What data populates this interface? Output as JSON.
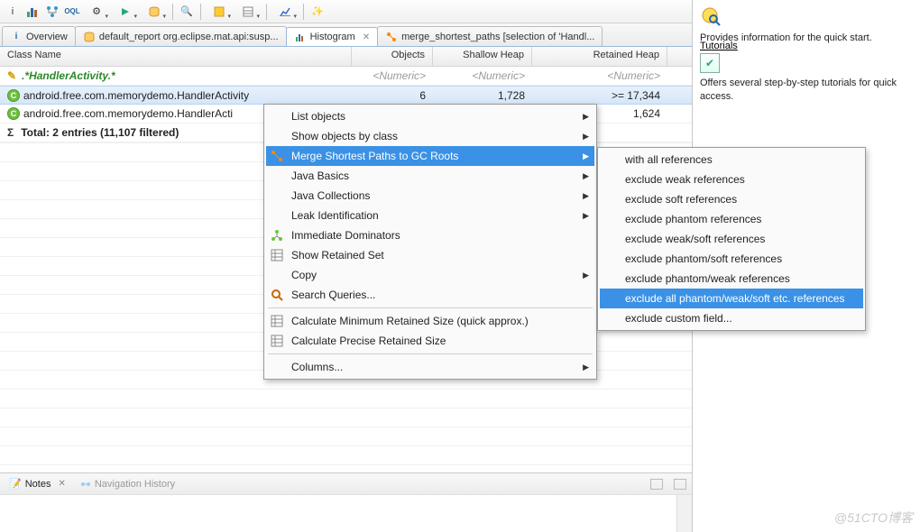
{
  "toolbar_icons": [
    "i",
    "bars",
    "tree",
    "OQL",
    "gear",
    "play",
    "db",
    "sep",
    "search",
    "cube",
    "table",
    "sep",
    "chart",
    "sep",
    "wand"
  ],
  "tabs": [
    {
      "icon": "i",
      "label": "Overview"
    },
    {
      "icon": "db",
      "label": "default_report  org.eclipse.mat.api:susp..."
    },
    {
      "icon": "histo",
      "label": "Histogram",
      "active": true,
      "closable": true
    },
    {
      "icon": "path",
      "label": "merge_shortest_paths [selection of 'Handl..."
    }
  ],
  "columns": [
    "Class Name",
    "Objects",
    "Shallow Heap",
    "Retained Heap"
  ],
  "numeric_placeholder": "<Numeric>",
  "regex_text": ".*HandlerActivity.*",
  "regex_icon": "R",
  "rows": [
    {
      "name": "android.free.com.memorydemo.HandlerActivity",
      "objects": "6",
      "shallow": "1,728",
      "retained": ">= 17,344",
      "selected": true
    },
    {
      "name": "android.free.com.memorydemo.HandlerActi",
      "objects": "",
      "shallow": "",
      "retained": "1,624"
    }
  ],
  "total_line_prefix": "Σ",
  "total_line": "Total: 2 entries (11,107 filtered)",
  "context_menu": [
    {
      "label": "List objects",
      "icon": "",
      "sub": true
    },
    {
      "label": "Show objects by class",
      "icon": "",
      "sub": true
    },
    {
      "label": "Merge Shortest Paths to GC Roots",
      "icon": "path",
      "sub": true,
      "hl": true
    },
    {
      "label": "Java Basics",
      "icon": "",
      "sub": true
    },
    {
      "label": "Java Collections",
      "icon": "",
      "sub": true
    },
    {
      "label": "Leak Identification",
      "icon": "",
      "sub": true
    },
    {
      "label": "Immediate Dominators",
      "icon": "dom"
    },
    {
      "label": "Show Retained Set",
      "icon": "grid"
    },
    {
      "label": "Copy",
      "icon": "",
      "sub": true
    },
    {
      "label": "Search Queries...",
      "icon": "search"
    },
    {
      "sep": true
    },
    {
      "label": "Calculate Minimum Retained Size (quick approx.)",
      "icon": "grid"
    },
    {
      "label": "Calculate Precise Retained Size",
      "icon": "grid"
    },
    {
      "sep": true
    },
    {
      "label": "Columns...",
      "icon": "",
      "sub": true
    }
  ],
  "sub_menu": [
    {
      "label": "with all references"
    },
    {
      "label": "exclude weak references"
    },
    {
      "label": "exclude soft references"
    },
    {
      "label": "exclude phantom references"
    },
    {
      "label": "exclude weak/soft references"
    },
    {
      "label": "exclude phantom/soft references"
    },
    {
      "label": "exclude phantom/weak references"
    },
    {
      "label": "exclude all phantom/weak/soft etc. references",
      "hl": true
    },
    {
      "label": "exclude custom field..."
    }
  ],
  "bottom_tabs": [
    {
      "icon": "note",
      "label": "Notes",
      "active": true,
      "closable": true
    },
    {
      "icon": "nav",
      "label": "Navigation History"
    }
  ],
  "right_panel": {
    "line1": "Provides information for the quick start.",
    "line2_title": "Tutorials",
    "line2": "Offers several step-by-step tutorials for quick access."
  },
  "watermark": "@51CTO博客"
}
